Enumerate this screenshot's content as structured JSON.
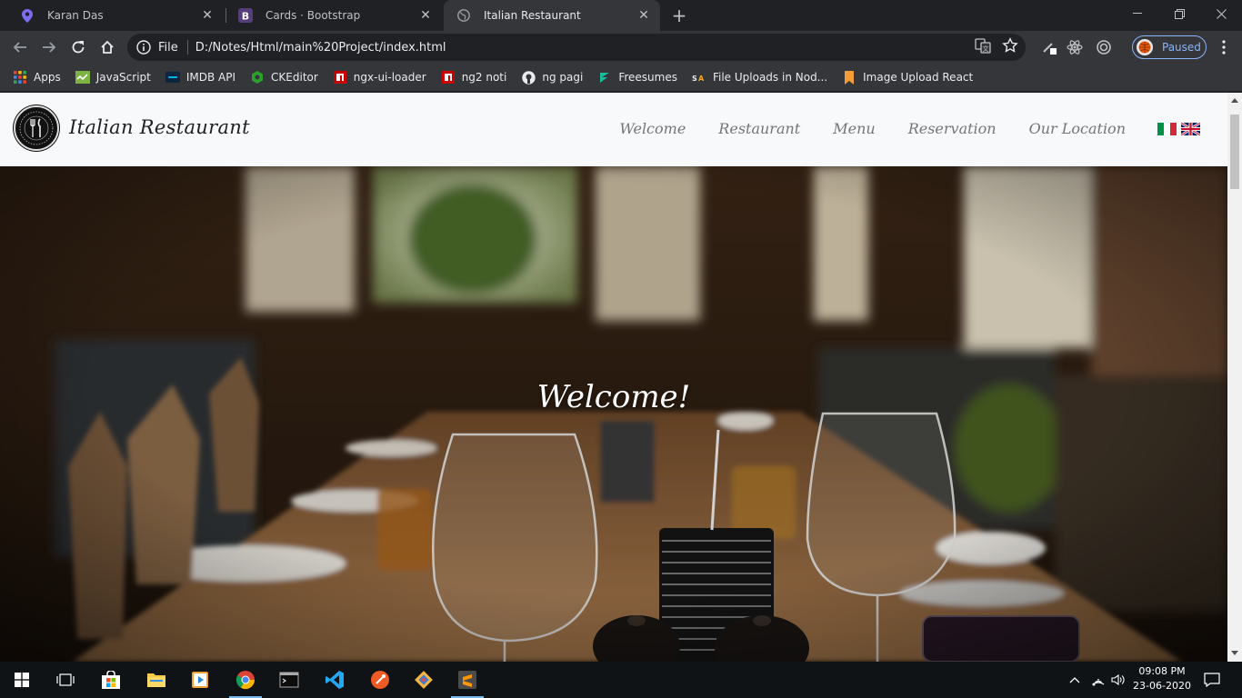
{
  "browser": {
    "tabs": [
      {
        "title": "Karan Das",
        "icon": "location-pin-icon",
        "active": false
      },
      {
        "title": "Cards · Bootstrap",
        "icon": "bootstrap-icon",
        "active": false
      },
      {
        "title": "Italian Restaurant",
        "icon": "globe-icon",
        "active": true
      }
    ],
    "address": {
      "scheme_label": "File",
      "url": "D:/Notes/Html/main%20Project/index.html"
    },
    "profile": {
      "label": "Paused"
    },
    "bookmarks": [
      {
        "label": "Apps",
        "icon": "apps-grid-icon"
      },
      {
        "label": "JavaScript",
        "icon": "javascript-icon"
      },
      {
        "label": "IMDB API",
        "icon": "imdb-icon"
      },
      {
        "label": "CKEditor",
        "icon": "ckeditor-icon"
      },
      {
        "label": "ngx-ui-loader",
        "icon": "npm-icon"
      },
      {
        "label": "ng2 noti",
        "icon": "npm-icon"
      },
      {
        "label": "ng pagi",
        "icon": "github-icon"
      },
      {
        "label": "Freesumes",
        "icon": "freesumes-icon"
      },
      {
        "label": "File Uploads in Nod...",
        "icon": "sa-icon"
      },
      {
        "label": "Image Upload React",
        "icon": "bookmark-icon"
      }
    ]
  },
  "site": {
    "brand": "Italian Restaurant",
    "nav": [
      "Welcome",
      "Restaurant",
      "Menu",
      "Reservation",
      "Our Location"
    ],
    "hero_heading": "Welcome!"
  },
  "taskbar": {
    "time": "09:08 PM",
    "date": "23-06-2020"
  },
  "colors": {
    "chrome_dark": "#202124",
    "chrome_toolbar": "#35363a",
    "navbar_bg": "#f8f9fa",
    "nav_link": "#757575",
    "profile_accent": "#8ab4f8"
  }
}
